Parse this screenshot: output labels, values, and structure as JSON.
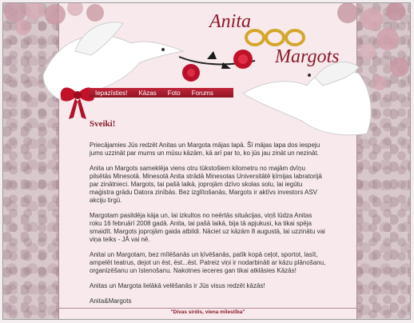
{
  "header": {
    "title_part1": "Anita",
    "title_part2": "Margots"
  },
  "nav": {
    "items": [
      {
        "label": "Iepazīsties!"
      },
      {
        "label": "Kāzas"
      },
      {
        "label": "Foto"
      },
      {
        "label": "Forums"
      }
    ]
  },
  "main": {
    "heading": "Sveiki!",
    "paragraphs": [
      "Priecājamies Jūs redzēt Anitas un Margota mājas lapā. Šī mājas lapa dos iespeju jums uzzināt par mums un mūsu kāzām, kā arī par to, ko jūs jau zināt un nezināt.",
      "Anita un Margots sameklēja viens otru tūkstošiem kilometru no majām dvīņu pilsētās Minesotā. Minesotā Anita strādā Minesotas Universitātē ķīmijas labratorijā par zinātnieci. Margots, tai pašā laikā, joprojām dzīvo skolas solu, lai iegūtu maģistra grādu Datora zinībās. Bez izglītošanās, Margots ir aktīvs investors ASV akciju tirgū.",
      "Margotam pasildēja kāja un, lai izkultos no neērtās situācijas, viņš lūdza Anitas roku 16 februārī 2008 gadā. Anita, tai pašā laikā, bija tā apjukusi, ka tikai spēja smaidīt. Margots joprojām gaida atbildi. Nāciet uz kāzām 8 augustā, lai uzzinātu vai viņa teiks - JĀ vai nē.",
      "Anitai un Margotam, bez mīlēšanās un ķīvēšanās, patīk kopā ceļot, sportot, lasīt, ampelēt teatrus, dejot un ēst, ēst...ēst. Patreiz viņi ir nodarbināti ar kāzu plānošanu, organizēšanu un īstenošanu. Nakotnes ieceres gan tikai atklāsies Kāzās!",
      "Anitas un Margota lielākā velēšanās ir Jūs visus redzēt kāzās!",
      "Anita&Margots"
    ]
  },
  "footer": {
    "text": "\"Divas sirdis, viena mīlestība\""
  },
  "colors": {
    "accent": "#8b1a2b",
    "nav_bg": "#b01e32",
    "content_bg": "#f7e9ec"
  }
}
